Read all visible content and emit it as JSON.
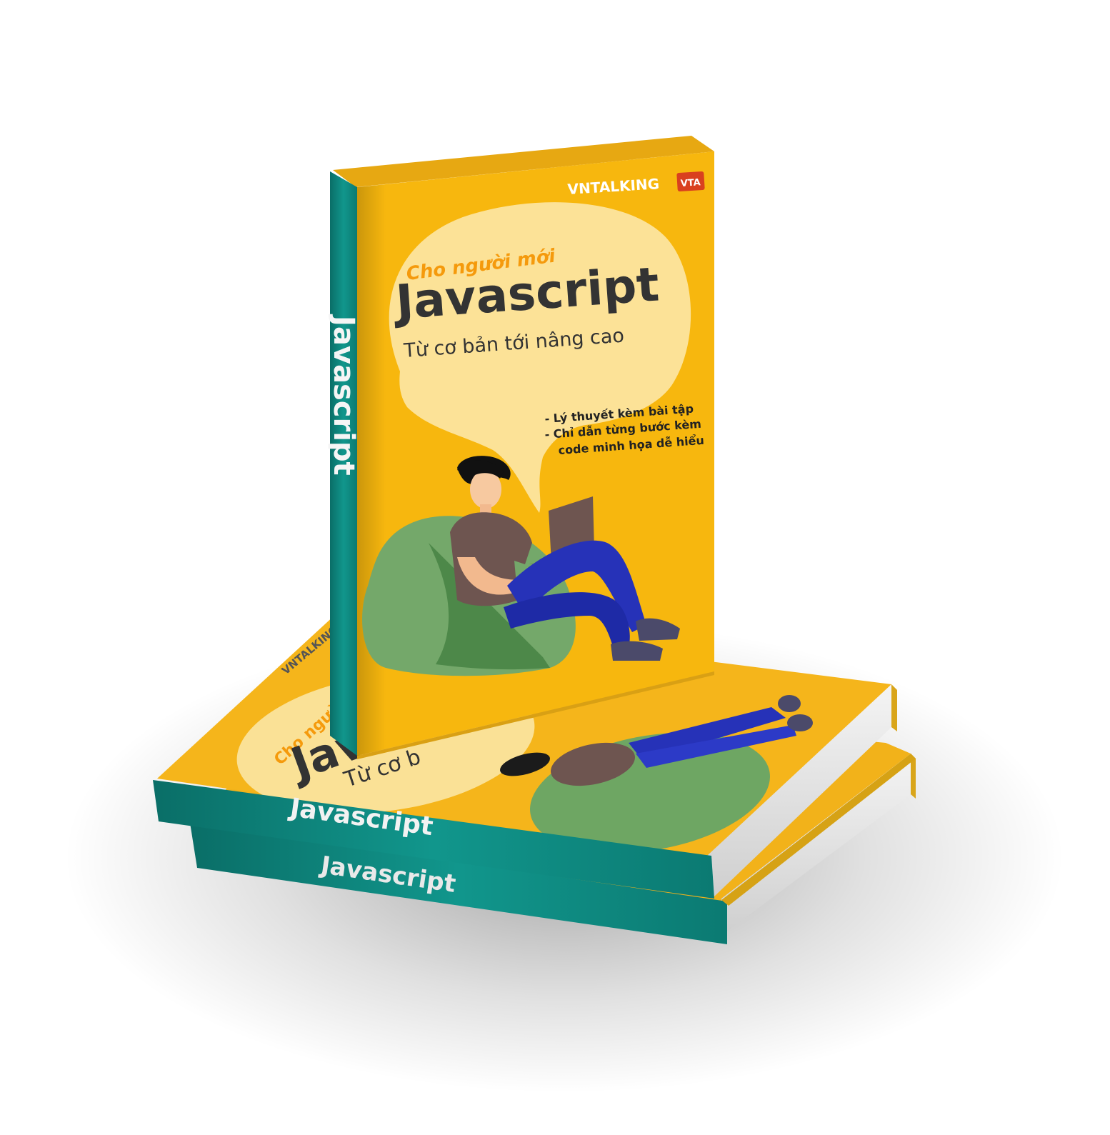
{
  "book": {
    "publisher": "VNTALKING",
    "publisher_badge": "VTA",
    "tagline": "Cho người mới",
    "title": "Javascript",
    "subtitle": "Từ cơ bản tới nâng cao",
    "features": [
      "- Lý thuyết kèm bài tập",
      "- Chỉ dẫn từng bước kèm",
      "code minh họa dễ hiểu"
    ],
    "spine_title": "Javascript"
  },
  "stack": {
    "top_spine_title": "Javascript",
    "bottom_spine_title": "Javascript",
    "lying_cover_publisher": "VNTALKING",
    "lying_cover_tagline": "Cho người mới",
    "lying_cover_title_fragment": "Jav",
    "lying_cover_subtitle_fragment": "Từ cơ b"
  },
  "colors": {
    "cover_yellow": "#F7B70E",
    "spine_teal": "#0E8C83",
    "bubble": "#FCE297",
    "title_dark": "#333333",
    "tagline_orange": "#F59A0C",
    "badge_red": "#D9401F",
    "beanbag_green": "#74A86A",
    "jeans_blue": "#2632B8",
    "shirt_brown": "#6E5550"
  },
  "icons": [
    "reader-illustration",
    "beanbag-illustration",
    "laptop-illustration"
  ]
}
